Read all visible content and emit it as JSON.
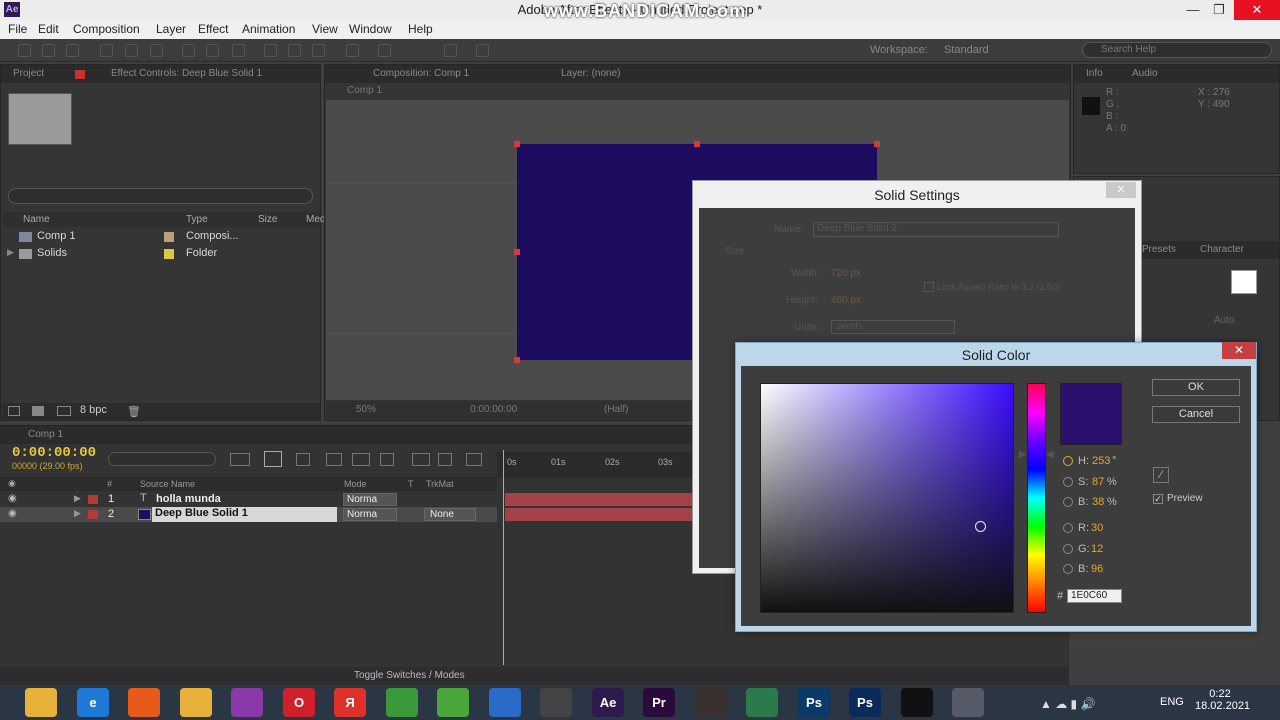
{
  "window": {
    "title": "Adobe After Effects - Untitled Project.aep *",
    "watermark": "www.BANDICAM.com",
    "app_icon_text": "Ae"
  },
  "menu": [
    "File",
    "Edit",
    "Composition",
    "Layer",
    "Effect",
    "Animation",
    "View",
    "Window",
    "Help"
  ],
  "toolbar": {
    "workspace_label": "Workspace:",
    "workspace_value": "Standard",
    "search_placeholder": "Search Help"
  },
  "project_panel": {
    "tab_project": "Project",
    "tab_effect_controls": "Effect Controls: Deep Blue Solid 1",
    "columns": [
      "Name",
      "Type",
      "Size",
      "Med"
    ],
    "items": [
      {
        "name": "Comp 1",
        "type": "Composi...",
        "label_color": "#b8a27a"
      },
      {
        "name": "Solids",
        "type": "Folder",
        "label_color": "#d8c84a"
      }
    ],
    "bpc": "8 bpc"
  },
  "comp_panel": {
    "tab": "Composition: Comp 1",
    "layer_tab": "Layer: (none)",
    "breadcrumb": "Comp 1",
    "zoom": "50%",
    "timecode": "0:00:00:00",
    "resolution": "(Half)",
    "solid_color": "#1e0c60"
  },
  "info_panel": {
    "tab_info": "Info",
    "tab_audio": "Audio",
    "r": "R :",
    "g": "G :",
    "b": "B :",
    "a": "A : 0",
    "x": "X : 276",
    "y": "Y : 490"
  },
  "char_panel": {
    "tab_presets": "Presets",
    "tab_character": "Character",
    "auto": "Auto"
  },
  "timeline": {
    "tab": "Comp 1",
    "timecode": "0:00:00:00",
    "fps": "00000 (29.00 fps)",
    "headers": {
      "source": "Source Name",
      "mode": "Mode",
      "t": "T",
      "trkmat": "TrkMat",
      "num": "#"
    },
    "ruler": [
      "0s",
      "01s",
      "02s",
      "03s"
    ],
    "layers": [
      {
        "num": "1",
        "name": "holla munda",
        "mode": "Norma",
        "trkmat": "",
        "color": "#b63a3a",
        "type_icon": "T"
      },
      {
        "num": "2",
        "name": "Deep Blue Solid 1",
        "mode": "Norma",
        "trkmat": "None",
        "color": "#b63a3a",
        "type_icon": ""
      }
    ],
    "toggle": "Toggle Switches / Modes"
  },
  "solid_settings": {
    "title": "Solid Settings",
    "name_label": "Name:",
    "name_value": "Deep Blue Solid 2",
    "size_label": "Size",
    "width_label": "Width:",
    "width_value": "720 px",
    "height_label": "Height:",
    "height_value": "480 px",
    "units_label": "Units:",
    "units_value": "pixels",
    "lock_label": "Lock Aspect Ratio to 3:2 (1.50)"
  },
  "solid_color": {
    "title": "Solid Color",
    "ok": "OK",
    "cancel": "Cancel",
    "preview": "Preview",
    "h_label": "H:",
    "h_value": "253",
    "h_unit": "°",
    "s_label": "S:",
    "s_value": "87",
    "s_unit": "%",
    "b_label": "B:",
    "b_value": "38",
    "b_unit": "%",
    "r_label": "R:",
    "r_value": "30",
    "g_label": "G:",
    "g_value": "12",
    "b2_label": "B:",
    "b2_value": "96",
    "hash": "#",
    "hex": "1E0C60",
    "preview_color": "#2a0f6e"
  },
  "taskbar": {
    "lang": "ENG",
    "time": "0:22",
    "date": "18.02.2021",
    "apps": [
      {
        "id": "explorer",
        "label": "",
        "color": "#e8b23a"
      },
      {
        "id": "ie",
        "label": "e",
        "color": "#1e78d7"
      },
      {
        "id": "app-orange",
        "label": "",
        "color": "#e85a1a"
      },
      {
        "id": "folder",
        "label": "",
        "color": "#e8b23a"
      },
      {
        "id": "winrar",
        "label": "",
        "color": "#8a3aa8"
      },
      {
        "id": "opera",
        "label": "O",
        "color": "#d0202a"
      },
      {
        "id": "yandex",
        "label": "Я",
        "color": "#e0302a"
      },
      {
        "id": "chrome",
        "label": "",
        "color": "#3a9a3a"
      },
      {
        "id": "utorrent",
        "label": "",
        "color": "#4aa83a"
      },
      {
        "id": "media",
        "label": "",
        "color": "#2a6ac8"
      },
      {
        "id": "console",
        "label": "",
        "color": "#444444"
      },
      {
        "id": "ae",
        "label": "Ae",
        "color": "#2d1b4e"
      },
      {
        "id": "pr",
        "label": "Pr",
        "color": "#2a0a3a"
      },
      {
        "id": "app-bird",
        "label": "",
        "color": "#3a3030"
      },
      {
        "id": "app-g",
        "label": "",
        "color": "#2a7a4a"
      },
      {
        "id": "ps1",
        "label": "Ps",
        "color": "#0a3a6a"
      },
      {
        "id": "ps2",
        "label": "Ps",
        "color": "#0a2a5a"
      },
      {
        "id": "bandicam",
        "label": "",
        "color": "#111111"
      },
      {
        "id": "screen",
        "label": "",
        "color": "#555a66"
      }
    ]
  }
}
